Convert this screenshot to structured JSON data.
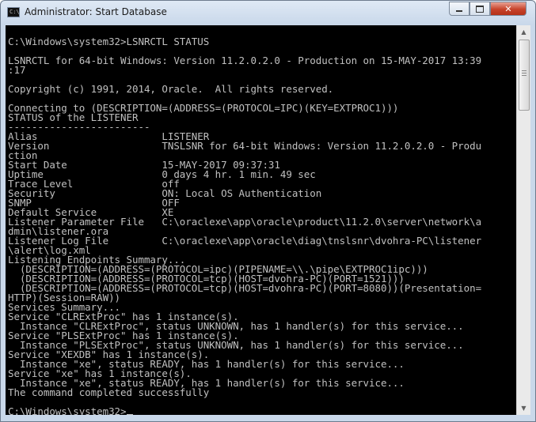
{
  "window": {
    "title": "Administrator: Start Database",
    "controls": {
      "minimize_icon": "minimize-icon",
      "maximize_icon": "maximize-icon",
      "close_glyph": "✕"
    }
  },
  "console": {
    "lines": [
      "",
      "C:\\Windows\\system32>LSNRCTL STATUS",
      "",
      "LSNRCTL for 64-bit Windows: Version 11.2.0.2.0 - Production on 15-MAY-2017 13:39",
      ":17",
      "",
      "Copyright (c) 1991, 2014, Oracle.  All rights reserved.",
      "",
      "Connecting to (DESCRIPTION=(ADDRESS=(PROTOCOL=IPC)(KEY=EXTPROC1)))",
      "STATUS of the LISTENER",
      "------------------------",
      "Alias                     LISTENER",
      "Version                   TNSLSNR for 64-bit Windows: Version 11.2.0.2.0 - Produ",
      "ction",
      "Start Date                15-MAY-2017 09:37:31",
      "Uptime                    0 days 4 hr. 1 min. 49 sec",
      "Trace Level               off",
      "Security                  ON: Local OS Authentication",
      "SNMP                      OFF",
      "Default Service           XE",
      "Listener Parameter File   C:\\oraclexe\\app\\oracle\\product\\11.2.0\\server\\network\\a",
      "dmin\\listener.ora",
      "Listener Log File         C:\\oraclexe\\app\\oracle\\diag\\tnslsnr\\dvohra-PC\\listener",
      "\\alert\\log.xml",
      "Listening Endpoints Summary...",
      "  (DESCRIPTION=(ADDRESS=(PROTOCOL=ipc)(PIPENAME=\\\\.\\pipe\\EXTPROC1ipc)))",
      "  (DESCRIPTION=(ADDRESS=(PROTOCOL=tcp)(HOST=dvohra-PC)(PORT=1521)))",
      "  (DESCRIPTION=(ADDRESS=(PROTOCOL=tcp)(HOST=dvohra-PC)(PORT=8080))(Presentation=",
      "HTTP)(Session=RAW))",
      "Services Summary...",
      "Service \"CLRExtProc\" has 1 instance(s).",
      "  Instance \"CLRExtProc\", status UNKNOWN, has 1 handler(s) for this service...",
      "Service \"PLSExtProc\" has 1 instance(s).",
      "  Instance \"PLSExtProc\", status UNKNOWN, has 1 handler(s) for this service...",
      "Service \"XEXDB\" has 1 instance(s).",
      "  Instance \"xe\", status READY, has 1 handler(s) for this service...",
      "Service \"xe\" has 1 instance(s).",
      "  Instance \"xe\", status READY, has 1 handler(s) for this service...",
      "The command completed successfully",
      "",
      "C:\\Windows\\system32>"
    ]
  },
  "scrollbar": {
    "up_icon": "scroll-up-arrow-icon",
    "down_icon": "scroll-down-arrow-icon",
    "position_fraction": 0.0
  }
}
